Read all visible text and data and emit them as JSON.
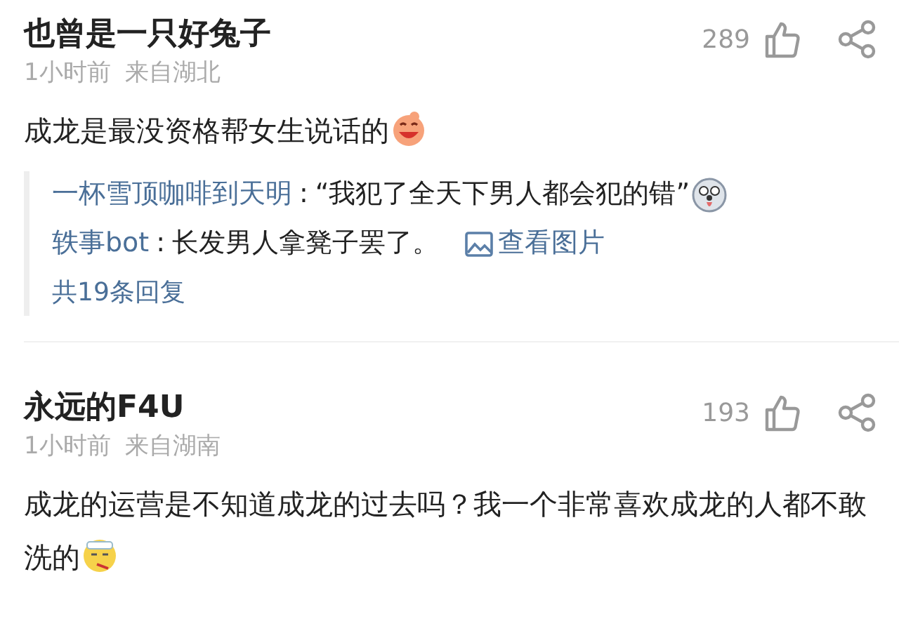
{
  "comments": [
    {
      "author": "也曾是一只好兔子",
      "time": "1小时前",
      "location": "来自湖北",
      "likes": "289",
      "text": "成龙是最没资格帮女生说话的",
      "emoji": {
        "kind": "laugh"
      },
      "replies": [
        {
          "author": "一杯雪顶咖啡到天明",
          "separator": ":",
          "text": "“我犯了全天下男人都会犯的错”",
          "emoji": {
            "kind": "dog"
          }
        },
        {
          "author": "轶事bot",
          "separator": ":",
          "text": "长发男人拿凳子罢了。",
          "image_link": "查看图片"
        }
      ],
      "more_replies": "共19条回复"
    },
    {
      "author": "永远的F4U",
      "time": "1小时前",
      "location": "来自湖南",
      "likes": "193",
      "text": "成龙的运营是不知道成龙的过去吗？我一个非常喜欢成龙的人都不敢洗的",
      "emoji": {
        "kind": "sick"
      }
    }
  ]
}
